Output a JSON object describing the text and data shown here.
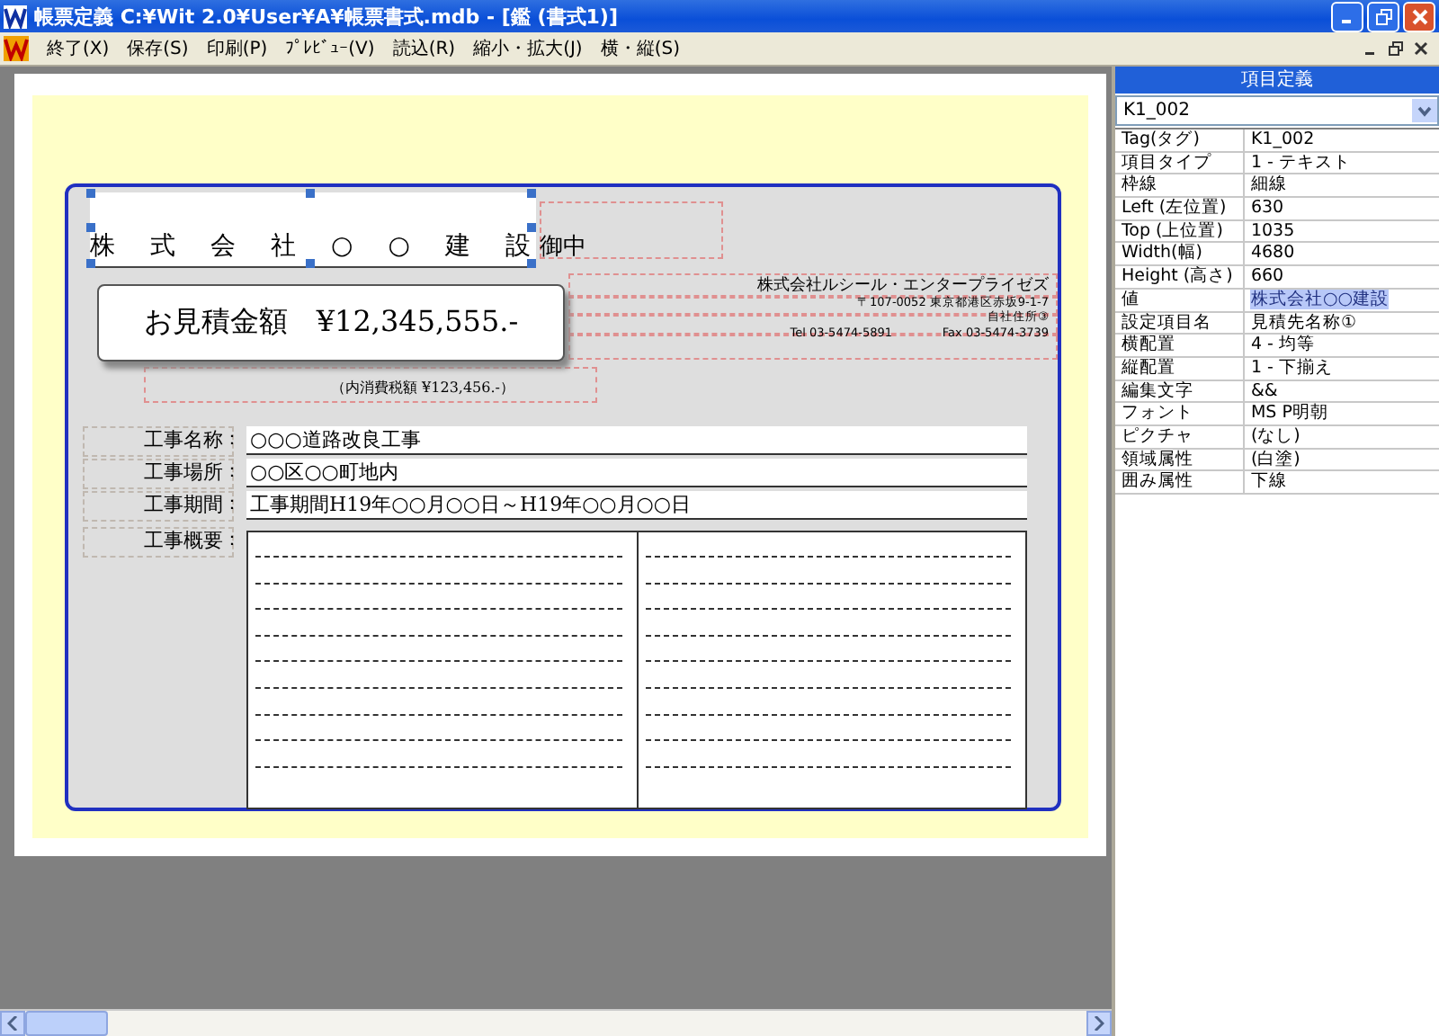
{
  "window": {
    "title": "帳票定義 C:¥Wit 2.0¥User¥A¥帳票書式.mdb - [鑑 (書式1)]"
  },
  "menu": [
    "終了(X)",
    "保存(S)",
    "印刷(P)",
    "ﾌﾟﾚﾋﾞｭｰ(V)",
    "読込(R)",
    "縮小・拡大(J)",
    "横・縦(S)"
  ],
  "form": {
    "recipient": {
      "value": "株式会社○○建設",
      "selected": true
    },
    "honorific": "御中",
    "estimate": "お見積金額　¥12,345,555.-",
    "tax": "（内消費税額 ¥123,456.-）",
    "company": {
      "name": "株式会社ルシール・エンタープライゼズ",
      "address": "〒107-0052 東京都港区赤坂9-1-7",
      "address_3": "自社住所③",
      "tel": "Tel 03-5474-5891",
      "fax": "Fax 03-5474-3739"
    },
    "fields": [
      {
        "label": "工事名称",
        "colon": "：",
        "value": "○○○道路改良工事"
      },
      {
        "label": "工事場所",
        "colon": "：",
        "value": "○○区○○町地内"
      },
      {
        "label": "工事期間",
        "colon": "：",
        "value": "工事期間H19年○○月○○日～H19年○○月○○日"
      }
    ],
    "summary": {
      "label": "工事概要",
      "colon": "："
    }
  },
  "properties": {
    "title": "項目定義",
    "selector": "K1_002",
    "rows": [
      {
        "name": "Tag(タグ)",
        "value": "K1_002",
        "selected": false
      },
      {
        "name": "項目タイプ",
        "value": "1 - テキスト",
        "selected": false
      },
      {
        "name": "枠線",
        "value": "細線",
        "selected": false
      },
      {
        "name": "Left (左位置)",
        "value": "630",
        "selected": false
      },
      {
        "name": "Top (上位置)",
        "value": "1035",
        "selected": false
      },
      {
        "name": "Width(幅)",
        "value": "4680",
        "selected": false
      },
      {
        "name": "Height (高さ)",
        "value": "660",
        "selected": false
      },
      {
        "name": "値",
        "value": "株式会社○○建設",
        "selected": true
      },
      {
        "name": "設定項目名",
        "value": "見積先名称①",
        "selected": false
      },
      {
        "name": "横配置",
        "value": "4 - 均等",
        "selected": false
      },
      {
        "name": "縦配置",
        "value": "1 - 下揃え",
        "selected": false
      },
      {
        "name": "編集文字",
        "value": "&&",
        "selected": false
      },
      {
        "name": "フォント",
        "value": "MS P明朝",
        "selected": false
      },
      {
        "name": "ピクチャ",
        "value": "(なし)",
        "selected": false
      },
      {
        "name": "領域属性",
        "value": "(白塗)",
        "selected": false
      },
      {
        "name": "囲み属性",
        "value": "下線",
        "selected": false
      }
    ]
  }
}
